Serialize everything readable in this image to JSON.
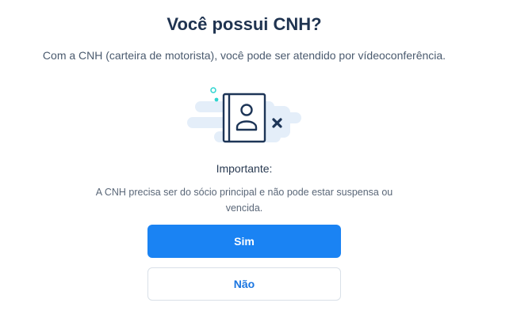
{
  "header": {
    "title": "Você possui CNH?",
    "subtitle": "Com a CNH (carteira de motorista), você pode ser atendido por vídeoconferência."
  },
  "illustration": {
    "icon": "driver-license-icon",
    "badge_icon": "close-icon"
  },
  "notice": {
    "label": "Importante:",
    "text": "A CNH precisa ser do sócio principal e não pode estar suspensa ou vencida."
  },
  "actions": {
    "yes_label": "Sim",
    "no_label": "Não"
  },
  "colors": {
    "primary": "#1a83f3",
    "title": "#1f3350",
    "icon_navy": "#1d3557",
    "accent_teal": "#2fd4d0",
    "cloud": "#e4eef9"
  }
}
